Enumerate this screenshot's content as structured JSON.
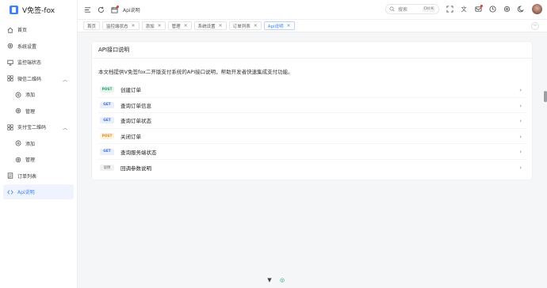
{
  "app": {
    "title": "V免签-fox"
  },
  "sidebar": {
    "items": [
      {
        "label": "首页",
        "icon": "home-icon"
      },
      {
        "label": "系统设置",
        "icon": "gear-icon"
      },
      {
        "label": "监控端状态",
        "icon": "monitor-icon"
      },
      {
        "label": "微信二维码",
        "icon": "grid-icon",
        "expandable": true
      },
      {
        "label": "添加",
        "icon": "plus-circle-icon",
        "sub": true
      },
      {
        "label": "管理",
        "icon": "gear-icon",
        "sub": true
      },
      {
        "label": "支付宝二维码",
        "icon": "grid-icon",
        "expandable": true
      },
      {
        "label": "添加",
        "icon": "plus-circle-icon",
        "sub": true
      },
      {
        "label": "管理",
        "icon": "gear-icon",
        "sub": true
      },
      {
        "label": "订单列表",
        "icon": "list-icon"
      },
      {
        "label": "Api说明",
        "icon": "code-icon",
        "active": true
      }
    ]
  },
  "header": {
    "breadcrumb": "Api说明",
    "search": {
      "placeholder": "搜索",
      "shortcut": "Ctrl K"
    }
  },
  "tabs": [
    {
      "label": "首页",
      "closable": false
    },
    {
      "label": "监控端状态",
      "closable": true
    },
    {
      "label": "添加",
      "closable": true
    },
    {
      "label": "管理",
      "closable": true
    },
    {
      "label": "系统设置",
      "closable": true
    },
    {
      "label": "订单列表",
      "closable": true
    },
    {
      "label": "Api说明",
      "closable": true,
      "active": true
    }
  ],
  "main": {
    "card_title": "API接口说明",
    "description": "本文档提供V免签fox二开版支付系统的API接口说明，帮助开发者快速集成支付功能。",
    "apis": [
      {
        "method": "POST",
        "name": "创建订单",
        "style": "post"
      },
      {
        "method": "GET",
        "name": "查询订单信息",
        "style": "get"
      },
      {
        "method": "GET",
        "name": "查询订单状态",
        "style": "get"
      },
      {
        "method": "POST",
        "name": "关闭订单",
        "style": "post-warn"
      },
      {
        "method": "GET",
        "name": "查询服务端状态",
        "style": "get"
      },
      {
        "method": "说明",
        "name": "回调参数说明",
        "style": "doc"
      }
    ]
  },
  "colors": {
    "accent": "#3b82f6",
    "post": "#22a06b",
    "get": "#3b6fd6",
    "warn": "#e48b1a"
  }
}
